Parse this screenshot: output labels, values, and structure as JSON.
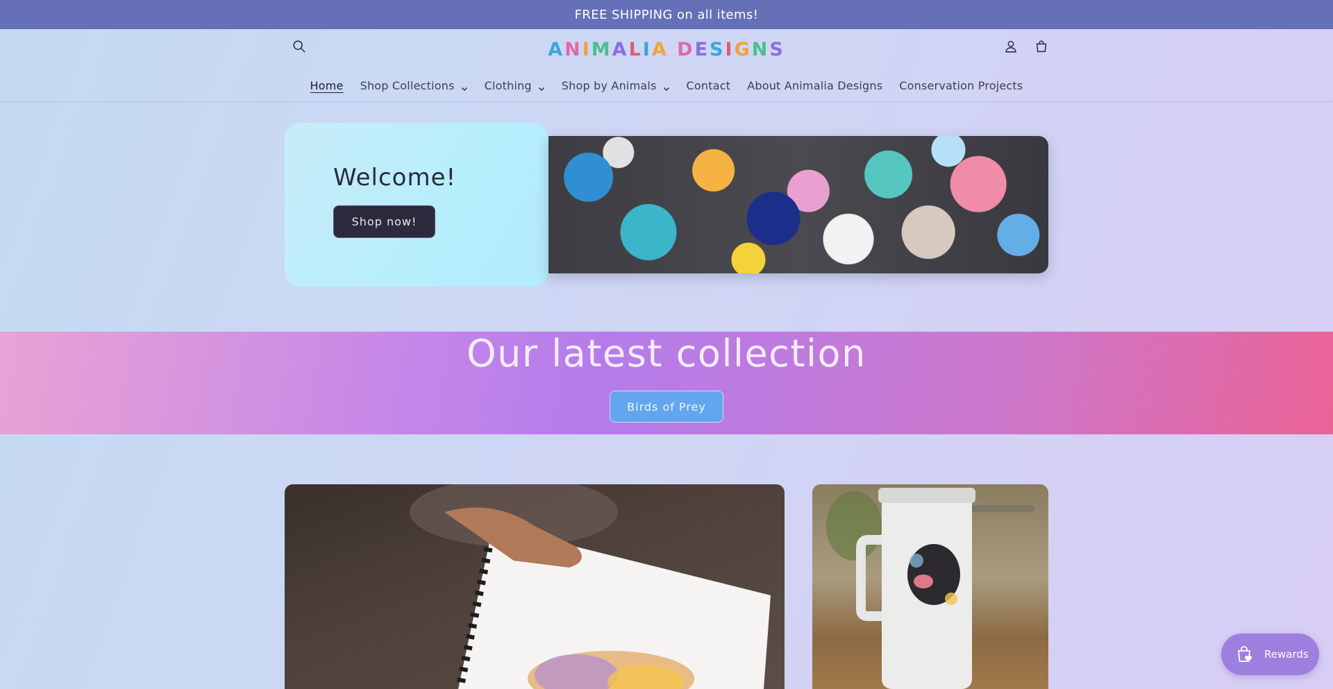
{
  "announcement": {
    "text": "FREE SHIPPING on all items!"
  },
  "header": {
    "logo_text": "ANIMALIA DESIGNS",
    "logo_colors": [
      "#3aa6d9",
      "#e06aa6",
      "#f0a33a",
      "#4bbf8f",
      "#8a6fe0",
      "#e05a7a",
      "#3aa6d9",
      "#f0a33a",
      "#4bbf8f",
      "#e06aa6",
      "#8a6fe0",
      "#3aa6d9",
      "#e05a7a",
      "#f0a33a",
      "#4bbf8f",
      "#8a6fe0"
    ],
    "icons": {
      "search": "search-icon",
      "account": "account-icon",
      "cart": "cart-icon"
    }
  },
  "nav": {
    "items": [
      {
        "label": "Home",
        "active": true,
        "dropdown": false
      },
      {
        "label": "Shop Collections",
        "active": false,
        "dropdown": true
      },
      {
        "label": "Clothing",
        "active": false,
        "dropdown": true
      },
      {
        "label": "Shop by Animals",
        "active": false,
        "dropdown": true
      },
      {
        "label": "Contact",
        "active": false,
        "dropdown": false
      },
      {
        "label": "About Animalia Designs",
        "active": false,
        "dropdown": false
      },
      {
        "label": "Conservation Projects",
        "active": false,
        "dropdown": false
      }
    ]
  },
  "hero": {
    "title": "Welcome!",
    "button_label": "Shop now!"
  },
  "collection": {
    "title": "Our latest collection",
    "button_label": "Birds of Prey"
  },
  "rewards": {
    "label": "Rewards"
  },
  "colors": {
    "announcement_bg": "#6670b6",
    "hero_button_bg": "#2e2a3d",
    "collection_button_bg": "#63a6ef",
    "rewards_bg": "#9d7fdf"
  }
}
